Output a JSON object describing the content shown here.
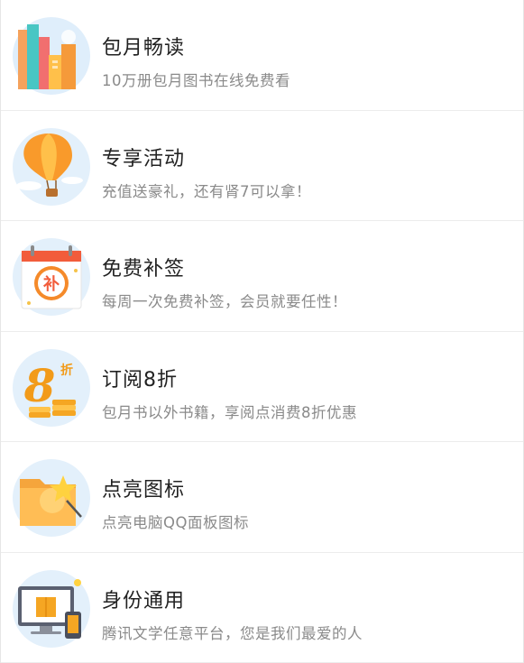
{
  "items": [
    {
      "title": "包月畅读",
      "subtitle": "10万册包月图书在线免费看",
      "icon": "books-icon"
    },
    {
      "title": "专享活动",
      "subtitle": "充值送豪礼，还有肾7可以拿！",
      "icon": "hot-air-balloon-icon"
    },
    {
      "title": "免费补签",
      "subtitle": "每周一次免费补签，会员就要任性！",
      "icon": "calendar-checkin-icon"
    },
    {
      "title": "订阅8折",
      "subtitle": "包月书以外书籍，享阅点消费8折优惠",
      "icon": "discount-coins-icon",
      "icon_text": {
        "digit": "8",
        "zhe": "折"
      }
    },
    {
      "title": "点亮图标",
      "subtitle": "点亮电脑QQ面板图标",
      "icon": "star-folder-icon"
    },
    {
      "title": "身份通用",
      "subtitle": "腾讯文学任意平台，您是我们最爱的人",
      "icon": "multi-device-icon"
    }
  ],
  "calendar_badge": "补"
}
